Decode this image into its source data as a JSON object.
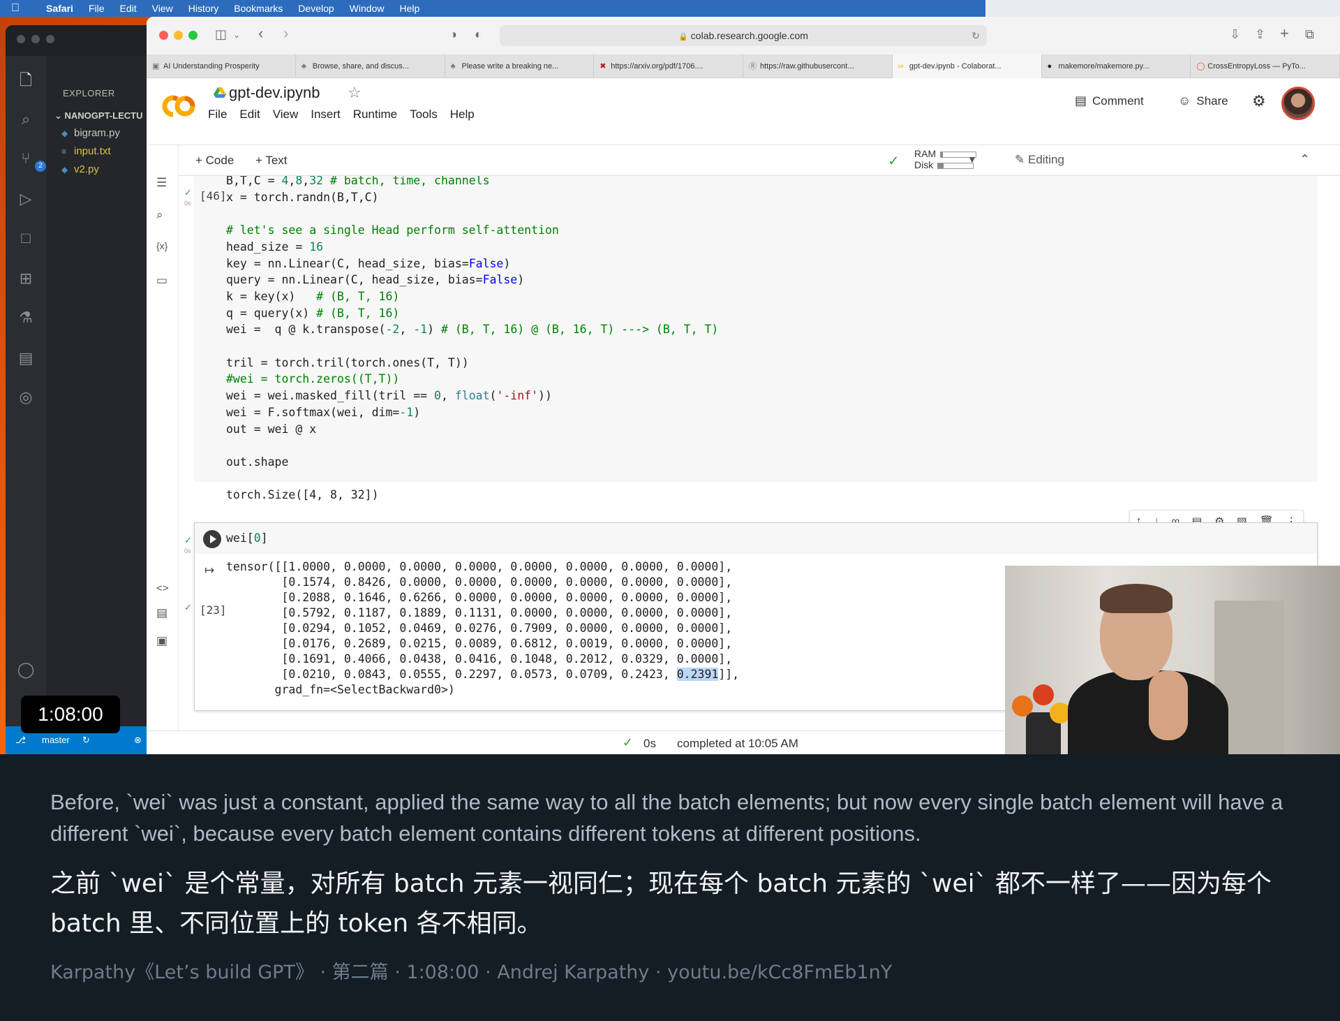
{
  "menubar": {
    "app": "Safari",
    "items": [
      "File",
      "Edit",
      "View",
      "History",
      "Bookmarks",
      "Develop",
      "Window",
      "Help"
    ]
  },
  "vscode": {
    "explorer_label": "EXPLORER",
    "folder": "NANOGPT-LECTU",
    "files": [
      "bigram.py",
      "input.txt",
      "v2.py"
    ],
    "scm_badge": "2",
    "branch": "master"
  },
  "video_timestamp": "1:08:00",
  "safari": {
    "url": "colab.research.google.com",
    "tabs": [
      "AI Understanding Prosperity",
      "Browse, share, and discus...",
      "Please write a breaking ne...",
      "https://arxiv.org/pdf/1706....",
      "https://raw.githubusercont...",
      "gpt-dev.ipynb - Colaborat...",
      "makemore/makemore.py...",
      "CrossEntropyLoss — PyTo..."
    ]
  },
  "colab": {
    "notebook_title": "gpt-dev.ipynb",
    "menu": [
      "File",
      "Edit",
      "View",
      "Insert",
      "Runtime",
      "Tools",
      "Help"
    ],
    "comment_label": "Comment",
    "share_label": "Share",
    "add_code": "+ Code",
    "add_text": "+ Text",
    "ram_label": "RAM",
    "disk_label": "Disk",
    "ram_fraction": 0.06,
    "disk_fraction": 0.15,
    "editing_label": "Editing",
    "cell1": {
      "exec_count": "[46]",
      "time": "0s",
      "output": "torch.Size([4, 8, 32])"
    },
    "cell2": {
      "code": "wei[0]",
      "time": "0s",
      "output_lines": [
        "tensor([[1.0000, 0.0000, 0.0000, 0.0000, 0.0000, 0.0000, 0.0000, 0.0000],",
        "        [0.1574, 0.8426, 0.0000, 0.0000, 0.0000, 0.0000, 0.0000, 0.0000],",
        "        [0.2088, 0.1646, 0.6266, 0.0000, 0.0000, 0.0000, 0.0000, 0.0000],",
        "        [0.5792, 0.1187, 0.1889, 0.1131, 0.0000, 0.0000, 0.0000, 0.0000],",
        "        [0.0294, 0.1052, 0.0469, 0.0276, 0.7909, 0.0000, 0.0000, 0.0000],",
        "        [0.0176, 0.2689, 0.0215, 0.0089, 0.6812, 0.0019, 0.0000, 0.0000],",
        "        [0.1691, 0.4066, 0.0438, 0.0416, 0.1048, 0.2012, 0.0329, 0.0000],"
      ],
      "last_line_prefix": "        [0.0210, 0.0843, 0.0555, 0.2297, 0.0573, 0.0709, 0.2423, ",
      "last_line_highlight": "0.2391",
      "last_line_suffix": "]],",
      "grad_line": "       grad_fn=<SelectBackward0>)"
    },
    "cell3_exec": "[23]",
    "status_time": "0s",
    "status_text": "completed at 10:05 AM"
  },
  "subtitles": {
    "english": "Before, `wei` was just a constant, applied the same way to all the batch elements; but now every single batch element will have a different `wei`, because every batch element contains different tokens at different positions.",
    "chinese": "之前 `wei` 是个常量，对所有 batch 元素一视同仁；现在每个 batch 元素的 `wei` 都不一样了——因为每个 batch 里、不同位置上的 token 各不相同。",
    "credit": "Karpathy《Let’s build GPT》 · 第二篇 · 1:08:00 · Andrej Karpathy · youtu.be/kCc8FmEb1nY"
  }
}
